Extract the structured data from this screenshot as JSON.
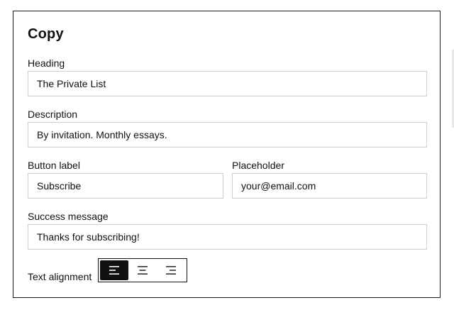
{
  "section": {
    "title": "Copy"
  },
  "fields": {
    "heading": {
      "label": "Heading",
      "value": "The Private List"
    },
    "description": {
      "label": "Description",
      "value": "By invitation. Monthly essays."
    },
    "button_label": {
      "label": "Button label",
      "value": "Subscribe"
    },
    "placeholder": {
      "label": "Placeholder",
      "value": "your@email.com"
    },
    "success_message": {
      "label": "Success message",
      "value": "Thanks for subscribing!"
    }
  },
  "alignment": {
    "label": "Text alignment",
    "options": [
      "align-left-icon",
      "align-center-icon",
      "align-right-icon"
    ],
    "selected": "left"
  },
  "colors": {
    "accent": "#111111",
    "field_border": "#cfcfcf"
  }
}
